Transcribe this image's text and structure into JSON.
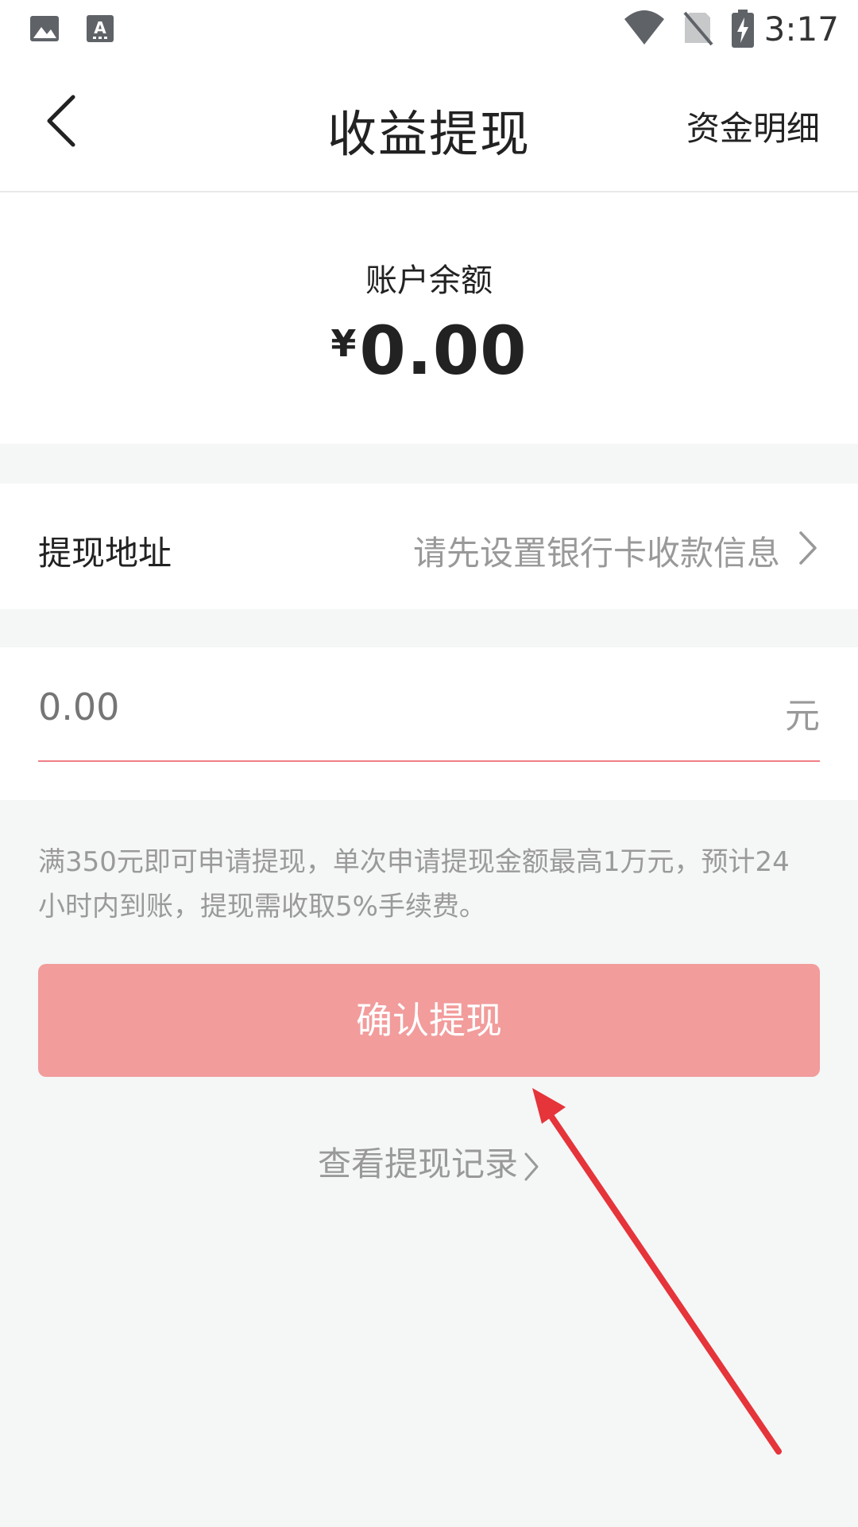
{
  "status_bar": {
    "time": "3:17",
    "left_icons": [
      "image-icon",
      "font-download-icon"
    ],
    "right_icons": [
      "wifi-icon",
      "no-sim-icon",
      "battery-charging-icon"
    ]
  },
  "header": {
    "title": "收益提现",
    "action_label": "资金明细",
    "back_icon": "back-arrow-icon"
  },
  "balance": {
    "label": "账户余额",
    "currency_symbol": "¥",
    "amount": "0.00"
  },
  "address": {
    "label": "提现地址",
    "hint": "请先设置银行卡收款信息"
  },
  "amount_input": {
    "placeholder": "0.00",
    "unit": "元",
    "underline_color": "#ef7f85"
  },
  "notice": {
    "text": "满350元即可申请提现，单次申请提现金额最高1万元，预计24小时内到账，提现需收取5%手续费。"
  },
  "confirm_button": {
    "label": "确认提现",
    "color": "#f29c9c"
  },
  "records_link": {
    "label": "查看提现记录"
  },
  "annotation": {
    "color": "#e5343a"
  }
}
